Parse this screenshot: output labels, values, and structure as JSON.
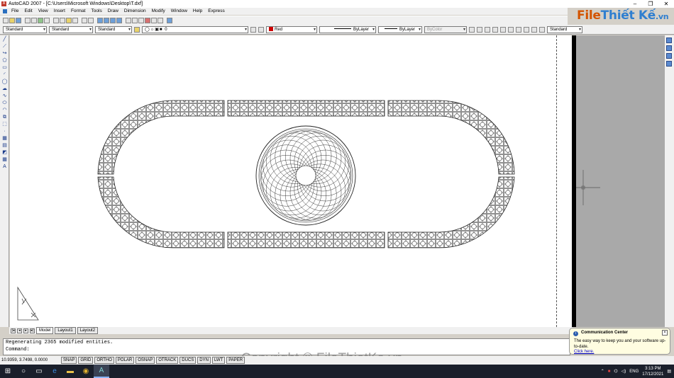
{
  "window": {
    "title": "AutoCAD 2007 - [C:\\Users\\Microsoft Windows\\Desktop\\T.dxf]",
    "minimize": "–",
    "restore": "❐",
    "close": "✕"
  },
  "menu": [
    "File",
    "Edit",
    "View",
    "Insert",
    "Format",
    "Tools",
    "Draw",
    "Dimension",
    "Modify",
    "Window",
    "Help",
    "Express"
  ],
  "toolbar2": {
    "text_style": "Standard",
    "dim_style": "Standard",
    "table_style": "Standard",
    "layer": "0",
    "color": "Red",
    "linetype": "ByLayer",
    "lineweight": "ByLayer",
    "plotstyle": "ByColor",
    "right_style": "Standard"
  },
  "colors": {
    "color_swatch": "#cc0000",
    "canvas": "#ffffff",
    "panel": "#a9a9a9"
  },
  "layout_tabs": [
    "Model",
    "Layout1",
    "Layout2"
  ],
  "command_lines": [
    "Regenerating 2365 modified entities.",
    "Command:"
  ],
  "status": {
    "coords": "10.9359, 3.7498, 0.0000",
    "toggles": [
      "SNAP",
      "GRID",
      "ORTHO",
      "POLAR",
      "OSNAP",
      "OTRACK",
      "DUCS",
      "DYN",
      "LWT",
      "PAPER"
    ]
  },
  "taskbar": {
    "lang": "ENG",
    "time": "3:13 PM",
    "date": "17/12/2021"
  },
  "popup": {
    "title": "Communication Center",
    "body": "The easy way to keep you and your software up-to-date.",
    "link": "Click here."
  },
  "watermark": {
    "logo_file": "File",
    "logo_rest": "Thiết Kế",
    "logo_suffix": ".vn",
    "copyright": "Copyright © FileThietKe.vn"
  }
}
